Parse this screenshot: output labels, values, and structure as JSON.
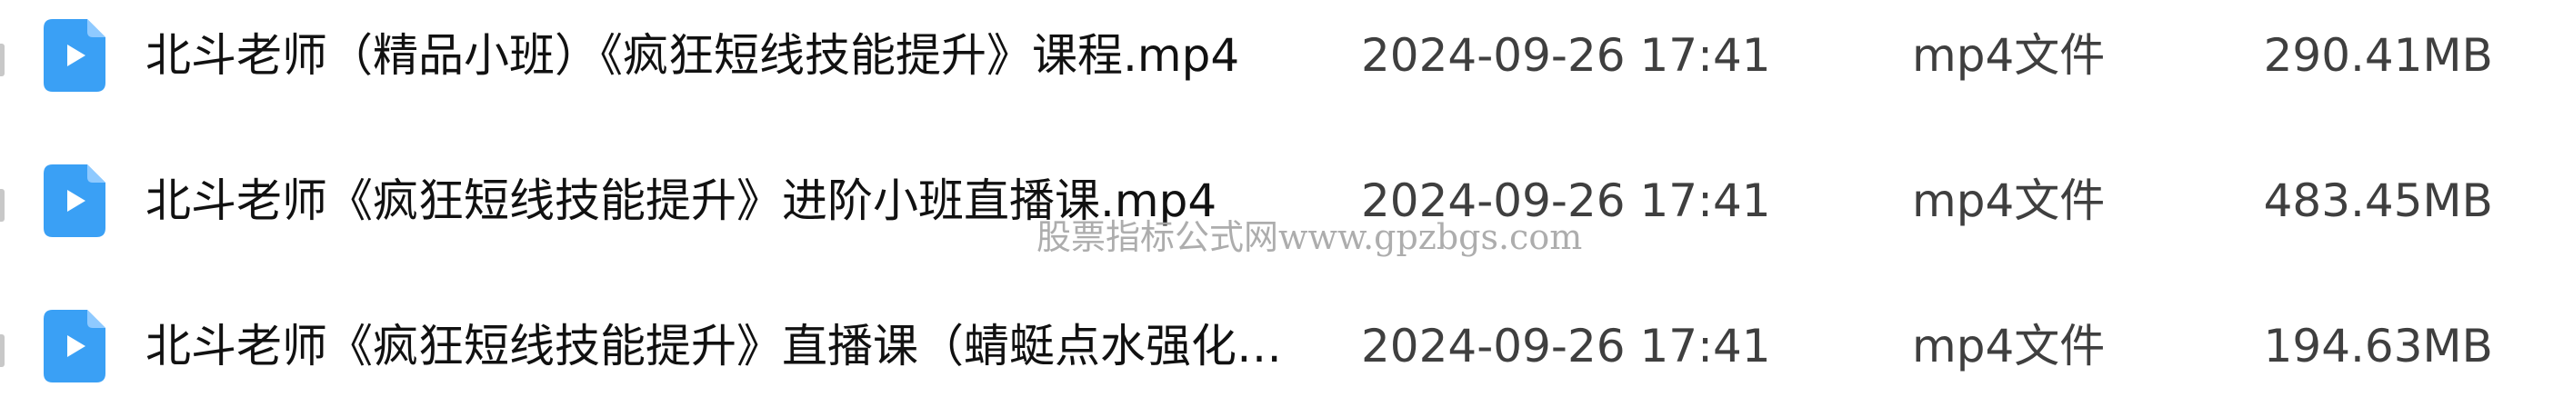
{
  "icons": {
    "file_icon": "video-file-icon",
    "file_icon_color": "#3aa0f5",
    "file_icon_fold_color": "#8fcaff"
  },
  "files": [
    {
      "name": "北斗老师（精品小班）《疯狂短线技能提升》课程.mp4",
      "modified": "2024-09-26 17:41",
      "type": "mp4文件",
      "size": "290.41MB"
    },
    {
      "name": "北斗老师《疯狂短线技能提升》进阶小班直播课.mp4",
      "modified": "2024-09-26 17:41",
      "type": "mp4文件",
      "size": "483.45MB"
    },
    {
      "name": "北斗老师《疯狂短线技能提升》直播课（蜻蜓点水强化）....",
      "modified": "2024-09-26 17:41",
      "type": "mp4文件",
      "size": "194.63MB"
    }
  ],
  "watermark": "股票指标公式网www.gpzbgs.com"
}
